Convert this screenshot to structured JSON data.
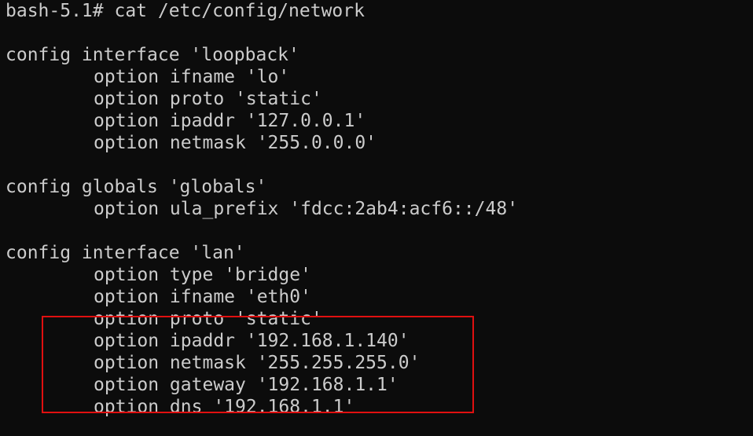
{
  "terminal": {
    "prompt_line": "bash-5.1# cat /etc/config/network",
    "blocks": [
      {
        "header": "config interface 'loopback'",
        "options": [
          "option ifname 'lo'",
          "option proto 'static'",
          "option ipaddr '127.0.0.1'",
          "option netmask '255.0.0.0'"
        ]
      },
      {
        "header": "config globals 'globals'",
        "options": [
          "option ula_prefix 'fdcc:2ab4:acf6::/48'"
        ]
      },
      {
        "header": "config interface 'lan'",
        "options": [
          "option type 'bridge'",
          "option ifname 'eth0'",
          "option proto 'static'",
          "option ipaddr '192.168.1.140'",
          "option netmask '255.255.255.0'",
          "option gateway '192.168.1.1'",
          "option dns '192.168.1.1'"
        ]
      }
    ]
  },
  "annotation": {
    "color": "#e01010"
  },
  "colors": {
    "background": "#0c0c0c",
    "text": "#cccccc"
  }
}
